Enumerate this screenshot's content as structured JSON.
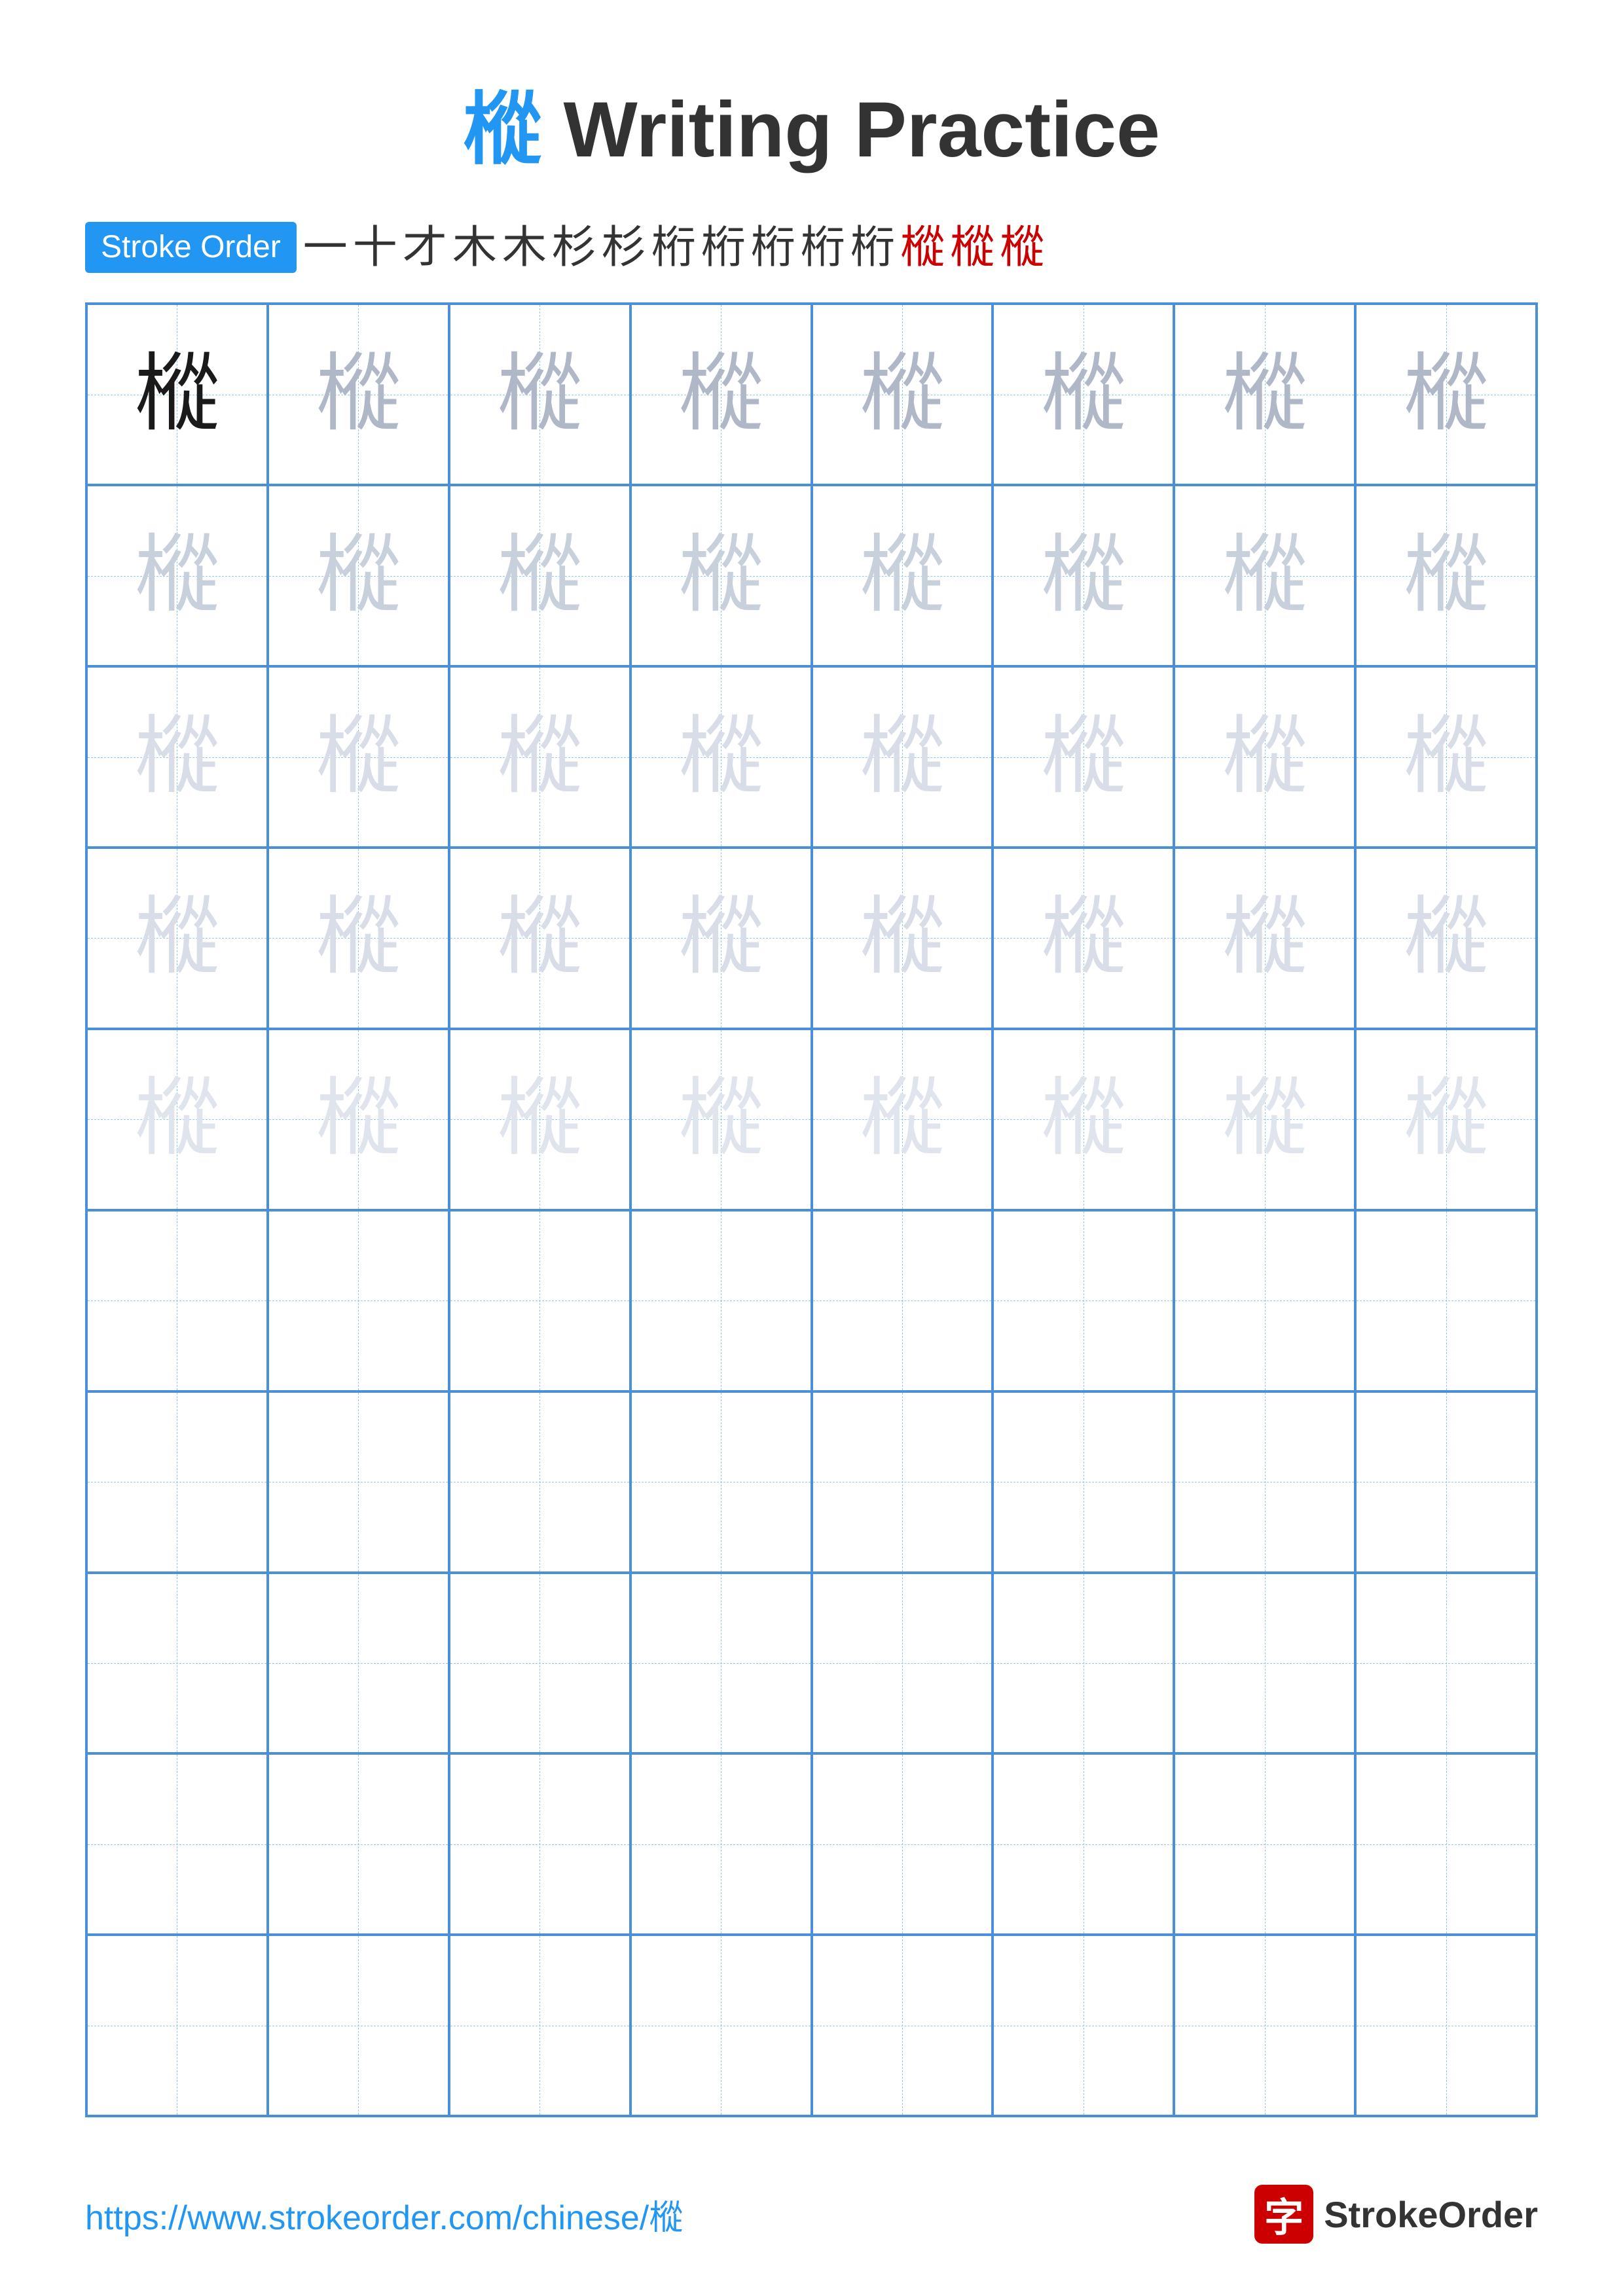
{
  "title": {
    "char": "樅",
    "text": " Writing Practice",
    "full": "樅 Writing Practice"
  },
  "stroke_order": {
    "badge_label": "Stroke Order",
    "strokes": [
      "一",
      "十",
      "才",
      "木",
      "木",
      "杉",
      "杉",
      "桁",
      "桁",
      "桁",
      "桁",
      "桁",
      "樅",
      "樅",
      "樅"
    ]
  },
  "practice": {
    "char": "樅",
    "rows": 10,
    "cols": 8,
    "filled_rows": 5,
    "empty_rows": 5,
    "row_shades": [
      "dark",
      "light1",
      "light2",
      "light3",
      "light4"
    ]
  },
  "footer": {
    "url": "https://www.strokeorder.com/chinese/樅",
    "brand_name": "StrokeOrder",
    "brand_char": "字"
  }
}
